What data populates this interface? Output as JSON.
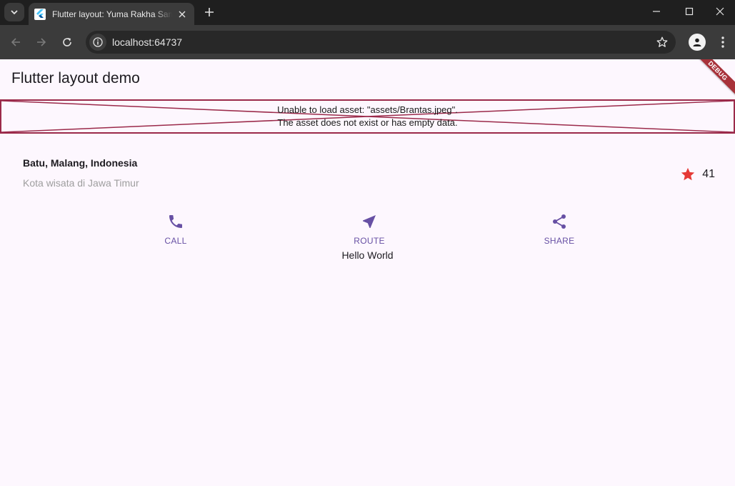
{
  "browser": {
    "tab_title": "Flutter layout: Yuma Rakha Samudra",
    "url": "localhost:64737"
  },
  "app": {
    "appbar_title": "Flutter layout demo",
    "debug_banner": "DEBUG",
    "image_error": {
      "line1": "Unable to load asset: \"assets/Brantas.jpeg\".",
      "line2": "The asset does not exist or has empty data."
    },
    "place": {
      "title": "Batu, Malang, Indonesia",
      "subtitle": "Kota wisata di Jawa Timur",
      "rating_count": "41"
    },
    "actions": [
      {
        "label": "CALL",
        "icon": "phone-icon"
      },
      {
        "label": "ROUTE",
        "icon": "near-me-icon"
      },
      {
        "label": "SHARE",
        "icon": "share-icon"
      }
    ],
    "body_text": "Hello World"
  },
  "colors": {
    "primary": "#6750a4",
    "star": "#e53935",
    "background": "#fdf7fe",
    "error_border": "#9b2a4a"
  }
}
